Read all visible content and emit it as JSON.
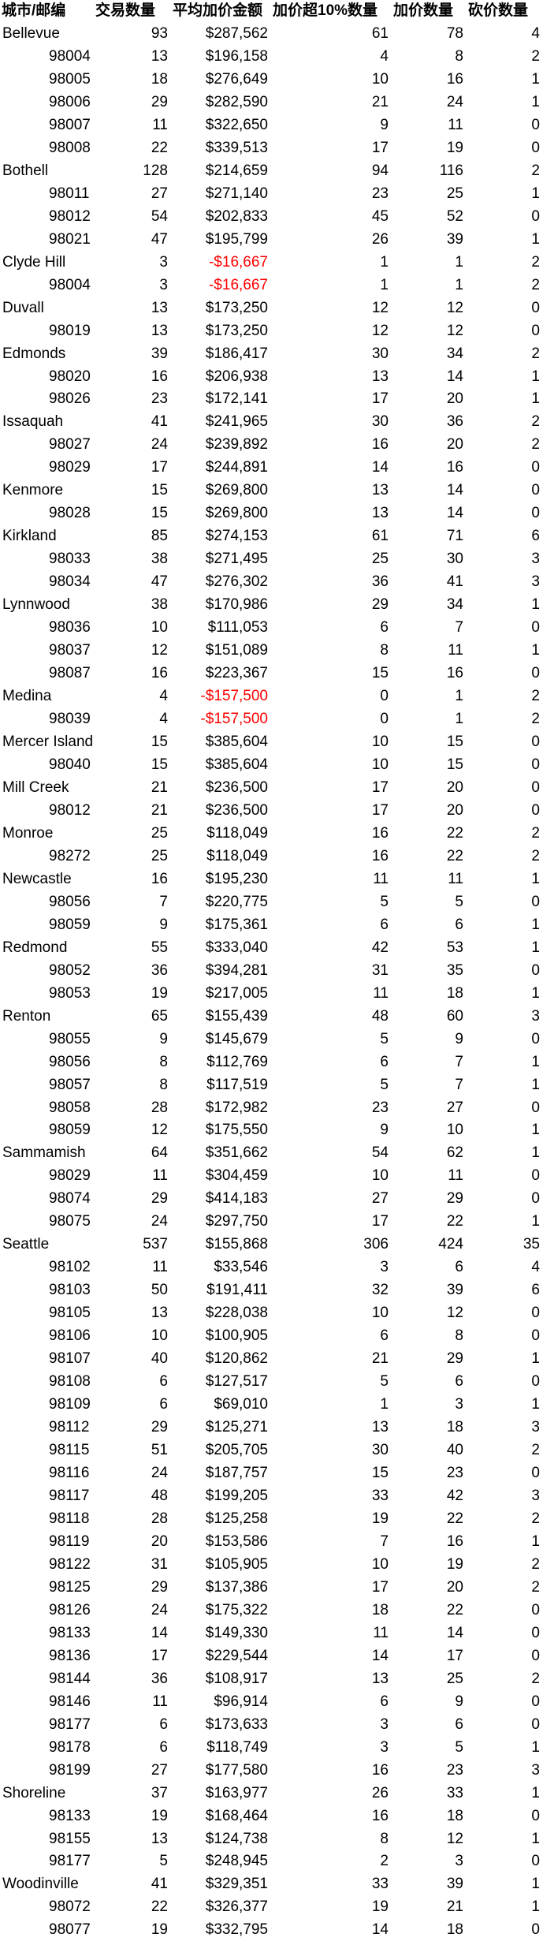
{
  "header": [
    "城市/邮编",
    "交易数量",
    "平均加价金额",
    "加价超10%数量",
    "加价数量",
    "砍价数量"
  ],
  "rows": [
    {
      "type": "city",
      "name": "Bellevue",
      "count": "93",
      "avg": "$287,562",
      "over10": "61",
      "markups": "78",
      "cuts": "4"
    },
    {
      "type": "zip",
      "name": "98004",
      "count": "13",
      "avg": "$196,158",
      "over10": "4",
      "markups": "8",
      "cuts": "2"
    },
    {
      "type": "zip",
      "name": "98005",
      "count": "18",
      "avg": "$276,649",
      "over10": "10",
      "markups": "16",
      "cuts": "1"
    },
    {
      "type": "zip",
      "name": "98006",
      "count": "29",
      "avg": "$282,590",
      "over10": "21",
      "markups": "24",
      "cuts": "1"
    },
    {
      "type": "zip",
      "name": "98007",
      "count": "11",
      "avg": "$322,650",
      "over10": "9",
      "markups": "11",
      "cuts": "0"
    },
    {
      "type": "zip",
      "name": "98008",
      "count": "22",
      "avg": "$339,513",
      "over10": "17",
      "markups": "19",
      "cuts": "0"
    },
    {
      "type": "city",
      "name": "Bothell",
      "count": "128",
      "avg": "$214,659",
      "over10": "94",
      "markups": "116",
      "cuts": "2"
    },
    {
      "type": "zip",
      "name": "98011",
      "count": "27",
      "avg": "$271,140",
      "over10": "23",
      "markups": "25",
      "cuts": "1"
    },
    {
      "type": "zip",
      "name": "98012",
      "count": "54",
      "avg": "$202,833",
      "over10": "45",
      "markups": "52",
      "cuts": "0"
    },
    {
      "type": "zip",
      "name": "98021",
      "count": "47",
      "avg": "$195,799",
      "over10": "26",
      "markups": "39",
      "cuts": "1"
    },
    {
      "type": "city",
      "name": "Clyde Hill",
      "count": "3",
      "avg": "-$16,667",
      "over10": "1",
      "markups": "1",
      "cuts": "2"
    },
    {
      "type": "zip",
      "name": "98004",
      "count": "3",
      "avg": "-$16,667",
      "over10": "1",
      "markups": "1",
      "cuts": "2"
    },
    {
      "type": "city",
      "name": "Duvall",
      "count": "13",
      "avg": "$173,250",
      "over10": "12",
      "markups": "12",
      "cuts": "0"
    },
    {
      "type": "zip",
      "name": "98019",
      "count": "13",
      "avg": "$173,250",
      "over10": "12",
      "markups": "12",
      "cuts": "0"
    },
    {
      "type": "city",
      "name": "Edmonds",
      "count": "39",
      "avg": "$186,417",
      "over10": "30",
      "markups": "34",
      "cuts": "2"
    },
    {
      "type": "zip",
      "name": "98020",
      "count": "16",
      "avg": "$206,938",
      "over10": "13",
      "markups": "14",
      "cuts": "1"
    },
    {
      "type": "zip",
      "name": "98026",
      "count": "23",
      "avg": "$172,141",
      "over10": "17",
      "markups": "20",
      "cuts": "1"
    },
    {
      "type": "city",
      "name": "Issaquah",
      "count": "41",
      "avg": "$241,965",
      "over10": "30",
      "markups": "36",
      "cuts": "2"
    },
    {
      "type": "zip",
      "name": "98027",
      "count": "24",
      "avg": "$239,892",
      "over10": "16",
      "markups": "20",
      "cuts": "2"
    },
    {
      "type": "zip",
      "name": "98029",
      "count": "17",
      "avg": "$244,891",
      "over10": "14",
      "markups": "16",
      "cuts": "0"
    },
    {
      "type": "city",
      "name": "Kenmore",
      "count": "15",
      "avg": "$269,800",
      "over10": "13",
      "markups": "14",
      "cuts": "0"
    },
    {
      "type": "zip",
      "name": "98028",
      "count": "15",
      "avg": "$269,800",
      "over10": "13",
      "markups": "14",
      "cuts": "0"
    },
    {
      "type": "city",
      "name": "Kirkland",
      "count": "85",
      "avg": "$274,153",
      "over10": "61",
      "markups": "71",
      "cuts": "6"
    },
    {
      "type": "zip",
      "name": "98033",
      "count": "38",
      "avg": "$271,495",
      "over10": "25",
      "markups": "30",
      "cuts": "3"
    },
    {
      "type": "zip",
      "name": "98034",
      "count": "47",
      "avg": "$276,302",
      "over10": "36",
      "markups": "41",
      "cuts": "3"
    },
    {
      "type": "city",
      "name": "Lynnwood",
      "count": "38",
      "avg": "$170,986",
      "over10": "29",
      "markups": "34",
      "cuts": "1"
    },
    {
      "type": "zip",
      "name": "98036",
      "count": "10",
      "avg": "$111,053",
      "over10": "6",
      "markups": "7",
      "cuts": "0"
    },
    {
      "type": "zip",
      "name": "98037",
      "count": "12",
      "avg": "$151,089",
      "over10": "8",
      "markups": "11",
      "cuts": "1"
    },
    {
      "type": "zip",
      "name": "98087",
      "count": "16",
      "avg": "$223,367",
      "over10": "15",
      "markups": "16",
      "cuts": "0"
    },
    {
      "type": "city",
      "name": "Medina",
      "count": "4",
      "avg": "-$157,500",
      "over10": "0",
      "markups": "1",
      "cuts": "2"
    },
    {
      "type": "zip",
      "name": "98039",
      "count": "4",
      "avg": "-$157,500",
      "over10": "0",
      "markups": "1",
      "cuts": "2"
    },
    {
      "type": "city",
      "name": "Mercer Island",
      "count": "15",
      "avg": "$385,604",
      "over10": "10",
      "markups": "15",
      "cuts": "0"
    },
    {
      "type": "zip",
      "name": "98040",
      "count": "15",
      "avg": "$385,604",
      "over10": "10",
      "markups": "15",
      "cuts": "0"
    },
    {
      "type": "city",
      "name": "Mill Creek",
      "count": "21",
      "avg": "$236,500",
      "over10": "17",
      "markups": "20",
      "cuts": "0"
    },
    {
      "type": "zip",
      "name": "98012",
      "count": "21",
      "avg": "$236,500",
      "over10": "17",
      "markups": "20",
      "cuts": "0"
    },
    {
      "type": "city",
      "name": "Monroe",
      "count": "25",
      "avg": "$118,049",
      "over10": "16",
      "markups": "22",
      "cuts": "2"
    },
    {
      "type": "zip",
      "name": "98272",
      "count": "25",
      "avg": "$118,049",
      "over10": "16",
      "markups": "22",
      "cuts": "2"
    },
    {
      "type": "city",
      "name": "Newcastle",
      "count": "16",
      "avg": "$195,230",
      "over10": "11",
      "markups": "11",
      "cuts": "1"
    },
    {
      "type": "zip",
      "name": "98056",
      "count": "7",
      "avg": "$220,775",
      "over10": "5",
      "markups": "5",
      "cuts": "0"
    },
    {
      "type": "zip",
      "name": "98059",
      "count": "9",
      "avg": "$175,361",
      "over10": "6",
      "markups": "6",
      "cuts": "1"
    },
    {
      "type": "city",
      "name": "Redmond",
      "count": "55",
      "avg": "$333,040",
      "over10": "42",
      "markups": "53",
      "cuts": "1"
    },
    {
      "type": "zip",
      "name": "98052",
      "count": "36",
      "avg": "$394,281",
      "over10": "31",
      "markups": "35",
      "cuts": "0"
    },
    {
      "type": "zip",
      "name": "98053",
      "count": "19",
      "avg": "$217,005",
      "over10": "11",
      "markups": "18",
      "cuts": "1"
    },
    {
      "type": "city",
      "name": "Renton",
      "count": "65",
      "avg": "$155,439",
      "over10": "48",
      "markups": "60",
      "cuts": "3"
    },
    {
      "type": "zip",
      "name": "98055",
      "count": "9",
      "avg": "$145,679",
      "over10": "5",
      "markups": "9",
      "cuts": "0"
    },
    {
      "type": "zip",
      "name": "98056",
      "count": "8",
      "avg": "$112,769",
      "over10": "6",
      "markups": "7",
      "cuts": "1"
    },
    {
      "type": "zip",
      "name": "98057",
      "count": "8",
      "avg": "$117,519",
      "over10": "5",
      "markups": "7",
      "cuts": "1"
    },
    {
      "type": "zip",
      "name": "98058",
      "count": "28",
      "avg": "$172,982",
      "over10": "23",
      "markups": "27",
      "cuts": "0"
    },
    {
      "type": "zip",
      "name": "98059",
      "count": "12",
      "avg": "$175,550",
      "over10": "9",
      "markups": "10",
      "cuts": "1"
    },
    {
      "type": "city",
      "name": "Sammamish",
      "count": "64",
      "avg": "$351,662",
      "over10": "54",
      "markups": "62",
      "cuts": "1"
    },
    {
      "type": "zip",
      "name": "98029",
      "count": "11",
      "avg": "$304,459",
      "over10": "10",
      "markups": "11",
      "cuts": "0"
    },
    {
      "type": "zip",
      "name": "98074",
      "count": "29",
      "avg": "$414,183",
      "over10": "27",
      "markups": "29",
      "cuts": "0"
    },
    {
      "type": "zip",
      "name": "98075",
      "count": "24",
      "avg": "$297,750",
      "over10": "17",
      "markups": "22",
      "cuts": "1"
    },
    {
      "type": "city",
      "name": "Seattle",
      "count": "537",
      "avg": "$155,868",
      "over10": "306",
      "markups": "424",
      "cuts": "35"
    },
    {
      "type": "zip",
      "name": "98102",
      "count": "11",
      "avg": "$33,546",
      "over10": "3",
      "markups": "6",
      "cuts": "4"
    },
    {
      "type": "zip",
      "name": "98103",
      "count": "50",
      "avg": "$191,411",
      "over10": "32",
      "markups": "39",
      "cuts": "6"
    },
    {
      "type": "zip",
      "name": "98105",
      "count": "13",
      "avg": "$228,038",
      "over10": "10",
      "markups": "12",
      "cuts": "0"
    },
    {
      "type": "zip",
      "name": "98106",
      "count": "10",
      "avg": "$100,905",
      "over10": "6",
      "markups": "8",
      "cuts": "0"
    },
    {
      "type": "zip",
      "name": "98107",
      "count": "40",
      "avg": "$120,862",
      "over10": "21",
      "markups": "29",
      "cuts": "1"
    },
    {
      "type": "zip",
      "name": "98108",
      "count": "6",
      "avg": "$127,517",
      "over10": "5",
      "markups": "6",
      "cuts": "0"
    },
    {
      "type": "zip",
      "name": "98109",
      "count": "6",
      "avg": "$69,010",
      "over10": "1",
      "markups": "3",
      "cuts": "1"
    },
    {
      "type": "zip",
      "name": "98112",
      "count": "29",
      "avg": "$125,271",
      "over10": "13",
      "markups": "18",
      "cuts": "3"
    },
    {
      "type": "zip",
      "name": "98115",
      "count": "51",
      "avg": "$205,705",
      "over10": "30",
      "markups": "40",
      "cuts": "2"
    },
    {
      "type": "zip",
      "name": "98116",
      "count": "24",
      "avg": "$187,757",
      "over10": "15",
      "markups": "23",
      "cuts": "0"
    },
    {
      "type": "zip",
      "name": "98117",
      "count": "48",
      "avg": "$199,205",
      "over10": "33",
      "markups": "42",
      "cuts": "3"
    },
    {
      "type": "zip",
      "name": "98118",
      "count": "28",
      "avg": "$125,258",
      "over10": "19",
      "markups": "22",
      "cuts": "2"
    },
    {
      "type": "zip",
      "name": "98119",
      "count": "20",
      "avg": "$153,586",
      "over10": "7",
      "markups": "16",
      "cuts": "1"
    },
    {
      "type": "zip",
      "name": "98122",
      "count": "31",
      "avg": "$105,905",
      "over10": "10",
      "markups": "19",
      "cuts": "2"
    },
    {
      "type": "zip",
      "name": "98125",
      "count": "29",
      "avg": "$137,386",
      "over10": "17",
      "markups": "20",
      "cuts": "2"
    },
    {
      "type": "zip",
      "name": "98126",
      "count": "24",
      "avg": "$175,322",
      "over10": "18",
      "markups": "22",
      "cuts": "0"
    },
    {
      "type": "zip",
      "name": "98133",
      "count": "14",
      "avg": "$149,330",
      "over10": "11",
      "markups": "14",
      "cuts": "0"
    },
    {
      "type": "zip",
      "name": "98136",
      "count": "17",
      "avg": "$229,544",
      "over10": "14",
      "markups": "17",
      "cuts": "0"
    },
    {
      "type": "zip",
      "name": "98144",
      "count": "36",
      "avg": "$108,917",
      "over10": "13",
      "markups": "25",
      "cuts": "2"
    },
    {
      "type": "zip",
      "name": "98146",
      "count": "11",
      "avg": "$96,914",
      "over10": "6",
      "markups": "9",
      "cuts": "0"
    },
    {
      "type": "zip",
      "name": "98177",
      "count": "6",
      "avg": "$173,633",
      "over10": "3",
      "markups": "6",
      "cuts": "0"
    },
    {
      "type": "zip",
      "name": "98178",
      "count": "6",
      "avg": "$118,749",
      "over10": "3",
      "markups": "5",
      "cuts": "1"
    },
    {
      "type": "zip",
      "name": "98199",
      "count": "27",
      "avg": "$177,580",
      "over10": "16",
      "markups": "23",
      "cuts": "3"
    },
    {
      "type": "city",
      "name": "Shoreline",
      "count": "37",
      "avg": "$163,977",
      "over10": "26",
      "markups": "33",
      "cuts": "1"
    },
    {
      "type": "zip",
      "name": "98133",
      "count": "19",
      "avg": "$168,464",
      "over10": "16",
      "markups": "18",
      "cuts": "0"
    },
    {
      "type": "zip",
      "name": "98155",
      "count": "13",
      "avg": "$124,738",
      "over10": "8",
      "markups": "12",
      "cuts": "1"
    },
    {
      "type": "zip",
      "name": "98177",
      "count": "5",
      "avg": "$248,945",
      "over10": "2",
      "markups": "3",
      "cuts": "0"
    },
    {
      "type": "city",
      "name": "Woodinville",
      "count": "41",
      "avg": "$329,351",
      "over10": "33",
      "markups": "39",
      "cuts": "1"
    },
    {
      "type": "zip",
      "name": "98072",
      "count": "22",
      "avg": "$326,377",
      "over10": "19",
      "markups": "21",
      "cuts": "1"
    },
    {
      "type": "zip",
      "name": "98077",
      "count": "19",
      "avg": "$332,795",
      "over10": "14",
      "markups": "18",
      "cuts": "0"
    }
  ]
}
